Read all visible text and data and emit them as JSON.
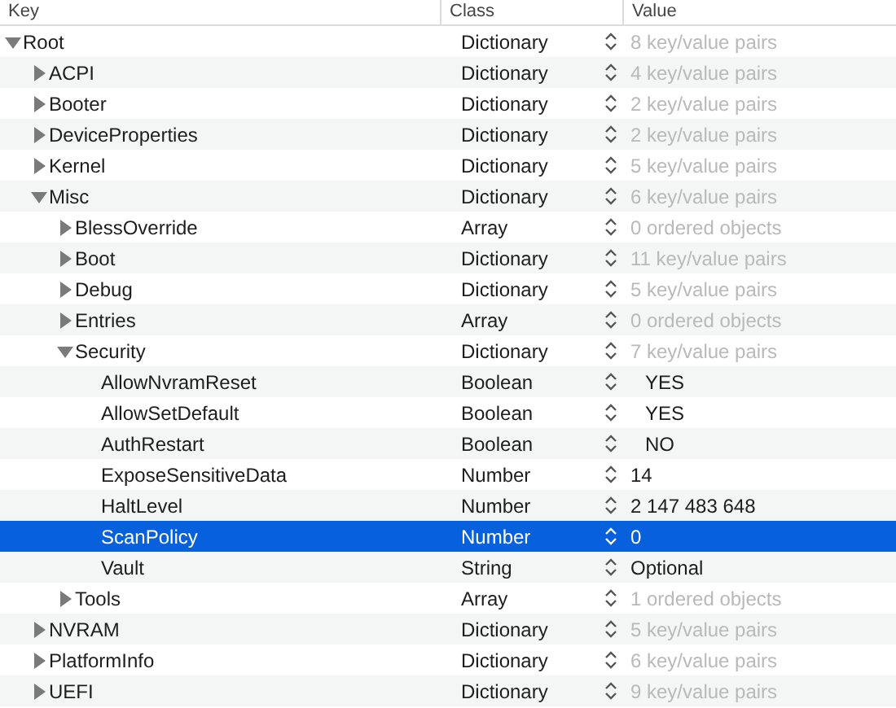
{
  "columns": [
    {
      "label": "Key"
    },
    {
      "label": "Class"
    },
    {
      "label": "Value"
    }
  ],
  "rows": [
    {
      "key": "Root",
      "class": "Dictionary",
      "value": "8 key/value pairs",
      "kind": "container",
      "expanded": true,
      "selected": false,
      "children": [
        {
          "key": "ACPI",
          "class": "Dictionary",
          "value": "4 key/value pairs",
          "kind": "container",
          "expanded": false,
          "selected": false
        },
        {
          "key": "Booter",
          "class": "Dictionary",
          "value": "2 key/value pairs",
          "kind": "container",
          "expanded": false,
          "selected": false
        },
        {
          "key": "DeviceProperties",
          "class": "Dictionary",
          "value": "2 key/value pairs",
          "kind": "container",
          "expanded": false,
          "selected": false
        },
        {
          "key": "Kernel",
          "class": "Dictionary",
          "value": "5 key/value pairs",
          "kind": "container",
          "expanded": false,
          "selected": false
        },
        {
          "key": "Misc",
          "class": "Dictionary",
          "value": "6 key/value pairs",
          "kind": "container",
          "expanded": true,
          "selected": false,
          "children": [
            {
              "key": "BlessOverride",
              "class": "Array",
              "value": "0 ordered objects",
              "kind": "container",
              "expanded": false,
              "selected": false
            },
            {
              "key": "Boot",
              "class": "Dictionary",
              "value": "11 key/value pairs",
              "kind": "container",
              "expanded": false,
              "selected": false
            },
            {
              "key": "Debug",
              "class": "Dictionary",
              "value": "5 key/value pairs",
              "kind": "container",
              "expanded": false,
              "selected": false
            },
            {
              "key": "Entries",
              "class": "Array",
              "value": "0 ordered objects",
              "kind": "container",
              "expanded": false,
              "selected": false
            },
            {
              "key": "Security",
              "class": "Dictionary",
              "value": "7 key/value pairs",
              "kind": "container",
              "expanded": true,
              "selected": false,
              "children": [
                {
                  "key": "AllowNvramReset",
                  "class": "Boolean",
                  "value": "YES",
                  "kind": "boolean",
                  "selected": false
                },
                {
                  "key": "AllowSetDefault",
                  "class": "Boolean",
                  "value": "YES",
                  "kind": "boolean",
                  "selected": false
                },
                {
                  "key": "AuthRestart",
                  "class": "Boolean",
                  "value": "NO",
                  "kind": "boolean",
                  "selected": false
                },
                {
                  "key": "ExposeSensitiveData",
                  "class": "Number",
                  "value": "14",
                  "kind": "scalar",
                  "selected": false
                },
                {
                  "key": "HaltLevel",
                  "class": "Number",
                  "value": "2 147 483 648",
                  "kind": "scalar",
                  "selected": false
                },
                {
                  "key": "ScanPolicy",
                  "class": "Number",
                  "value": "0",
                  "kind": "scalar",
                  "selected": true
                },
                {
                  "key": "Vault",
                  "class": "String",
                  "value": "Optional",
                  "kind": "scalar",
                  "selected": false
                }
              ]
            },
            {
              "key": "Tools",
              "class": "Array",
              "value": "1 ordered objects",
              "kind": "container",
              "expanded": false,
              "selected": false
            }
          ]
        },
        {
          "key": "NVRAM",
          "class": "Dictionary",
          "value": "5 key/value pairs",
          "kind": "container",
          "expanded": false,
          "selected": false
        },
        {
          "key": "PlatformInfo",
          "class": "Dictionary",
          "value": "6 key/value pairs",
          "kind": "container",
          "expanded": false,
          "selected": false
        },
        {
          "key": "UEFI",
          "class": "Dictionary",
          "value": "9 key/value pairs",
          "kind": "container",
          "expanded": false,
          "selected": false
        }
      ]
    }
  ]
}
